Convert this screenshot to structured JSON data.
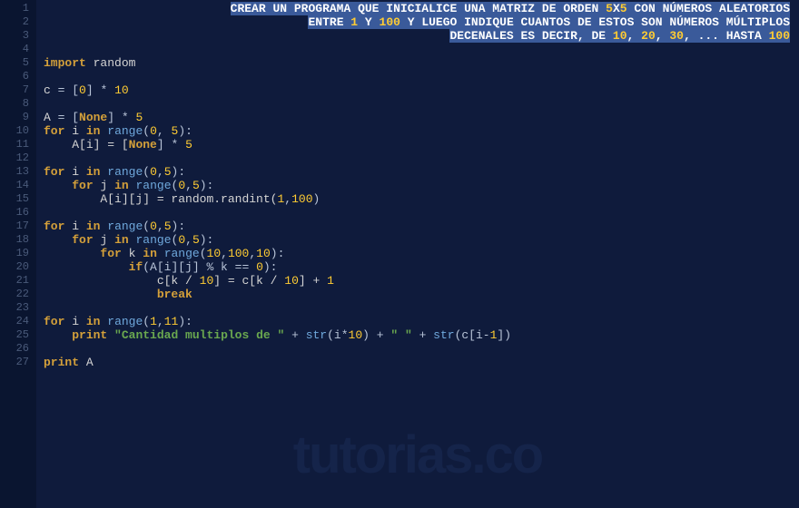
{
  "title_comment": {
    "line1_pre": "CREAR UN PROGRAMA QUE INICIALICE UNA MATRIZ DE ORDEN ",
    "line1_n1": "5",
    "line1_mid": "X",
    "line1_n2": "5",
    "line1_post": " CON NÚMEROS ALEATORIOS",
    "line2_pre": "ENTRE ",
    "line2_n1": "1",
    "line2_mid1": " Y ",
    "line2_n2": "100",
    "line2_post": " Y LUEGO INDIQUE CUANTOS DE ESTOS SON NÚMEROS MÚLTIPLOS",
    "line3_pre": "DECENALES ES DECIR, DE ",
    "line3_n1": "10",
    "line3_sep1": ", ",
    "line3_n2": "20",
    "line3_sep2": ", ",
    "line3_n3": "30",
    "line3_mid": ", ... HASTA ",
    "line3_n4": "100"
  },
  "code": {
    "import_kw": "import",
    "import_mod": "random",
    "c_assign_var": "c",
    "c_assign_eq": " = [",
    "c_assign_zero": "0",
    "c_assign_post": "] * ",
    "c_assign_ten": "10",
    "a_assign_var": "A",
    "a_assign_eq": " = [",
    "a_assign_none": "None",
    "a_assign_post": "] * ",
    "a_assign_five": "5",
    "for_kw": "for",
    "in_kw": "in",
    "range_fn": "range",
    "i_var": "i",
    "j_var": "j",
    "k_var": "k",
    "zero": "0",
    "five": "5",
    "one": "1",
    "ten": "10",
    "eleven": "11",
    "hundred": "100",
    "none_const": "None",
    "ai_assign": "A[i] = [",
    "ai_post": "] * ",
    "aij_assign": "A[i][j] = random.randint(",
    "if_kw": "if",
    "if_cond_pre": "(A[i][j] % k == ",
    "if_cond_post": "):",
    "ck_pre": "c[k / ",
    "ck_mid": "] = c[k / ",
    "ck_post": "] + ",
    "break_kw": "break",
    "print_kw": "print",
    "print_str1": "\"Cantidad multiplos de \"",
    "print_str2": "\" \"",
    "str_fn": "str",
    "print_a": "A"
  },
  "watermark": "tutorias.co",
  "line_count": 27
}
